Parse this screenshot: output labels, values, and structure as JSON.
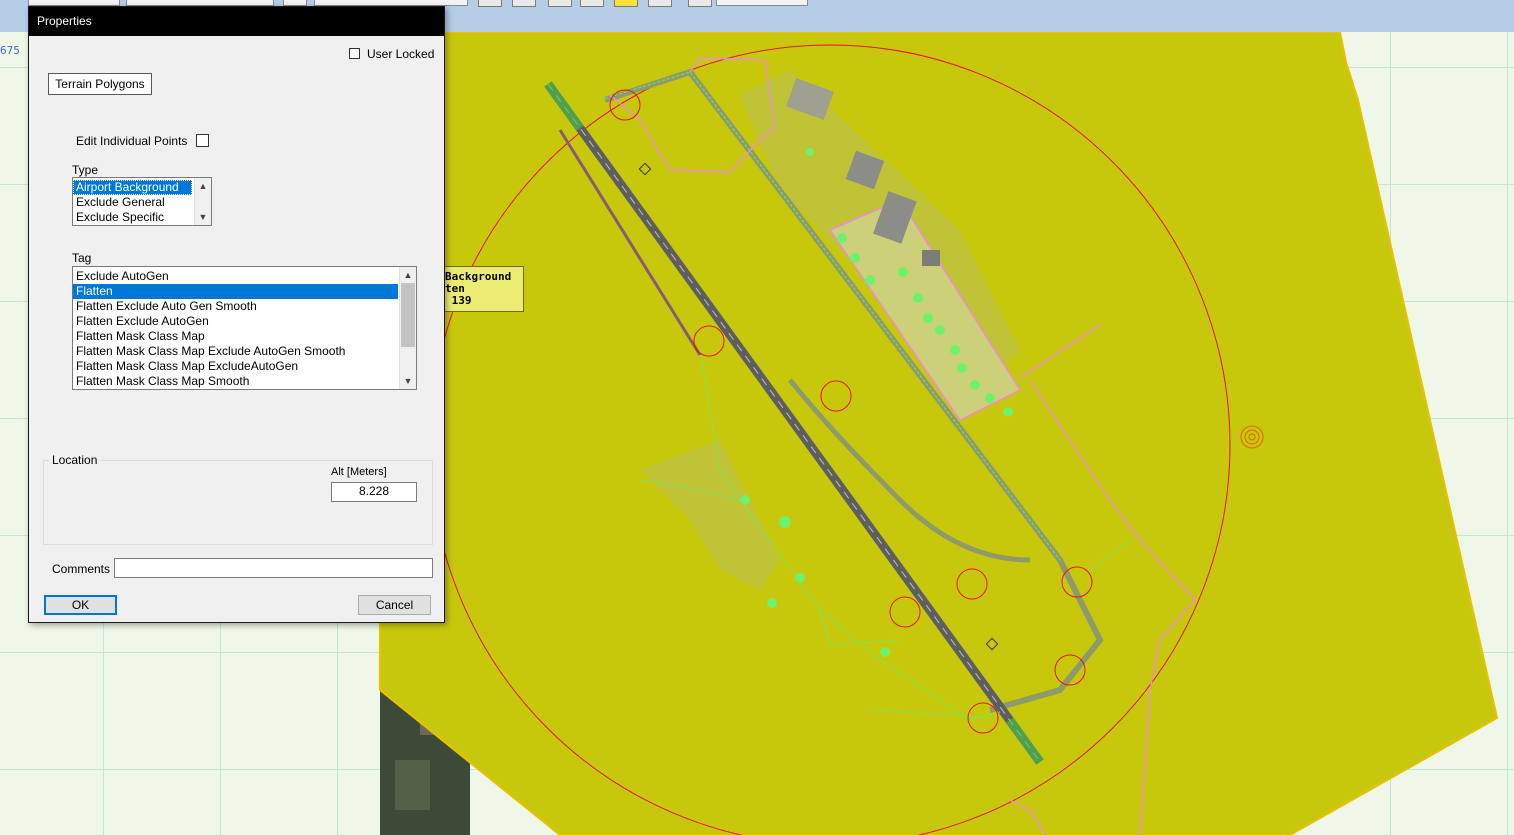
{
  "map": {
    "coord_text": "675",
    "selection_label": [
      "Background",
      "ten",
      " 139"
    ]
  },
  "dialog": {
    "title": "Properties",
    "user_locked_label": "User Locked",
    "user_locked_checked": false,
    "category_button": "Terrain Polygons",
    "edit_points_label": "Edit Individual Points",
    "edit_points_checked": false,
    "type": {
      "label": "Type",
      "options": [
        "Airport Background",
        "Exclude General",
        "Exclude Specific"
      ],
      "selected": "Airport Background"
    },
    "tag": {
      "label": "Tag",
      "options": [
        "Exclude AutoGen",
        "Flatten",
        "Flatten Exclude Auto Gen Smooth",
        "Flatten Exclude AutoGen",
        "Flatten Mask Class Map",
        "Flatten Mask Class Map Exclude AutoGen Smooth",
        "Flatten Mask Class Map ExcludeAutoGen",
        "Flatten Mask Class Map Smooth"
      ],
      "selected": "Flatten"
    },
    "location": {
      "label": "Location",
      "alt_label": "Alt [Meters]",
      "alt_value": "8.228"
    },
    "comments_label": "Comments",
    "comments_value": "",
    "ok_label": "OK",
    "cancel_label": "Cancel"
  },
  "colors": {
    "polygon_fill": "#c7c80c",
    "polygon_edge": "#e8c200",
    "radius_circle": "#e81010",
    "taxiway_green": "#55ee55",
    "fence_pink": "#ee88dd",
    "runway": "#606060",
    "selection_blue": "#0078d7"
  }
}
